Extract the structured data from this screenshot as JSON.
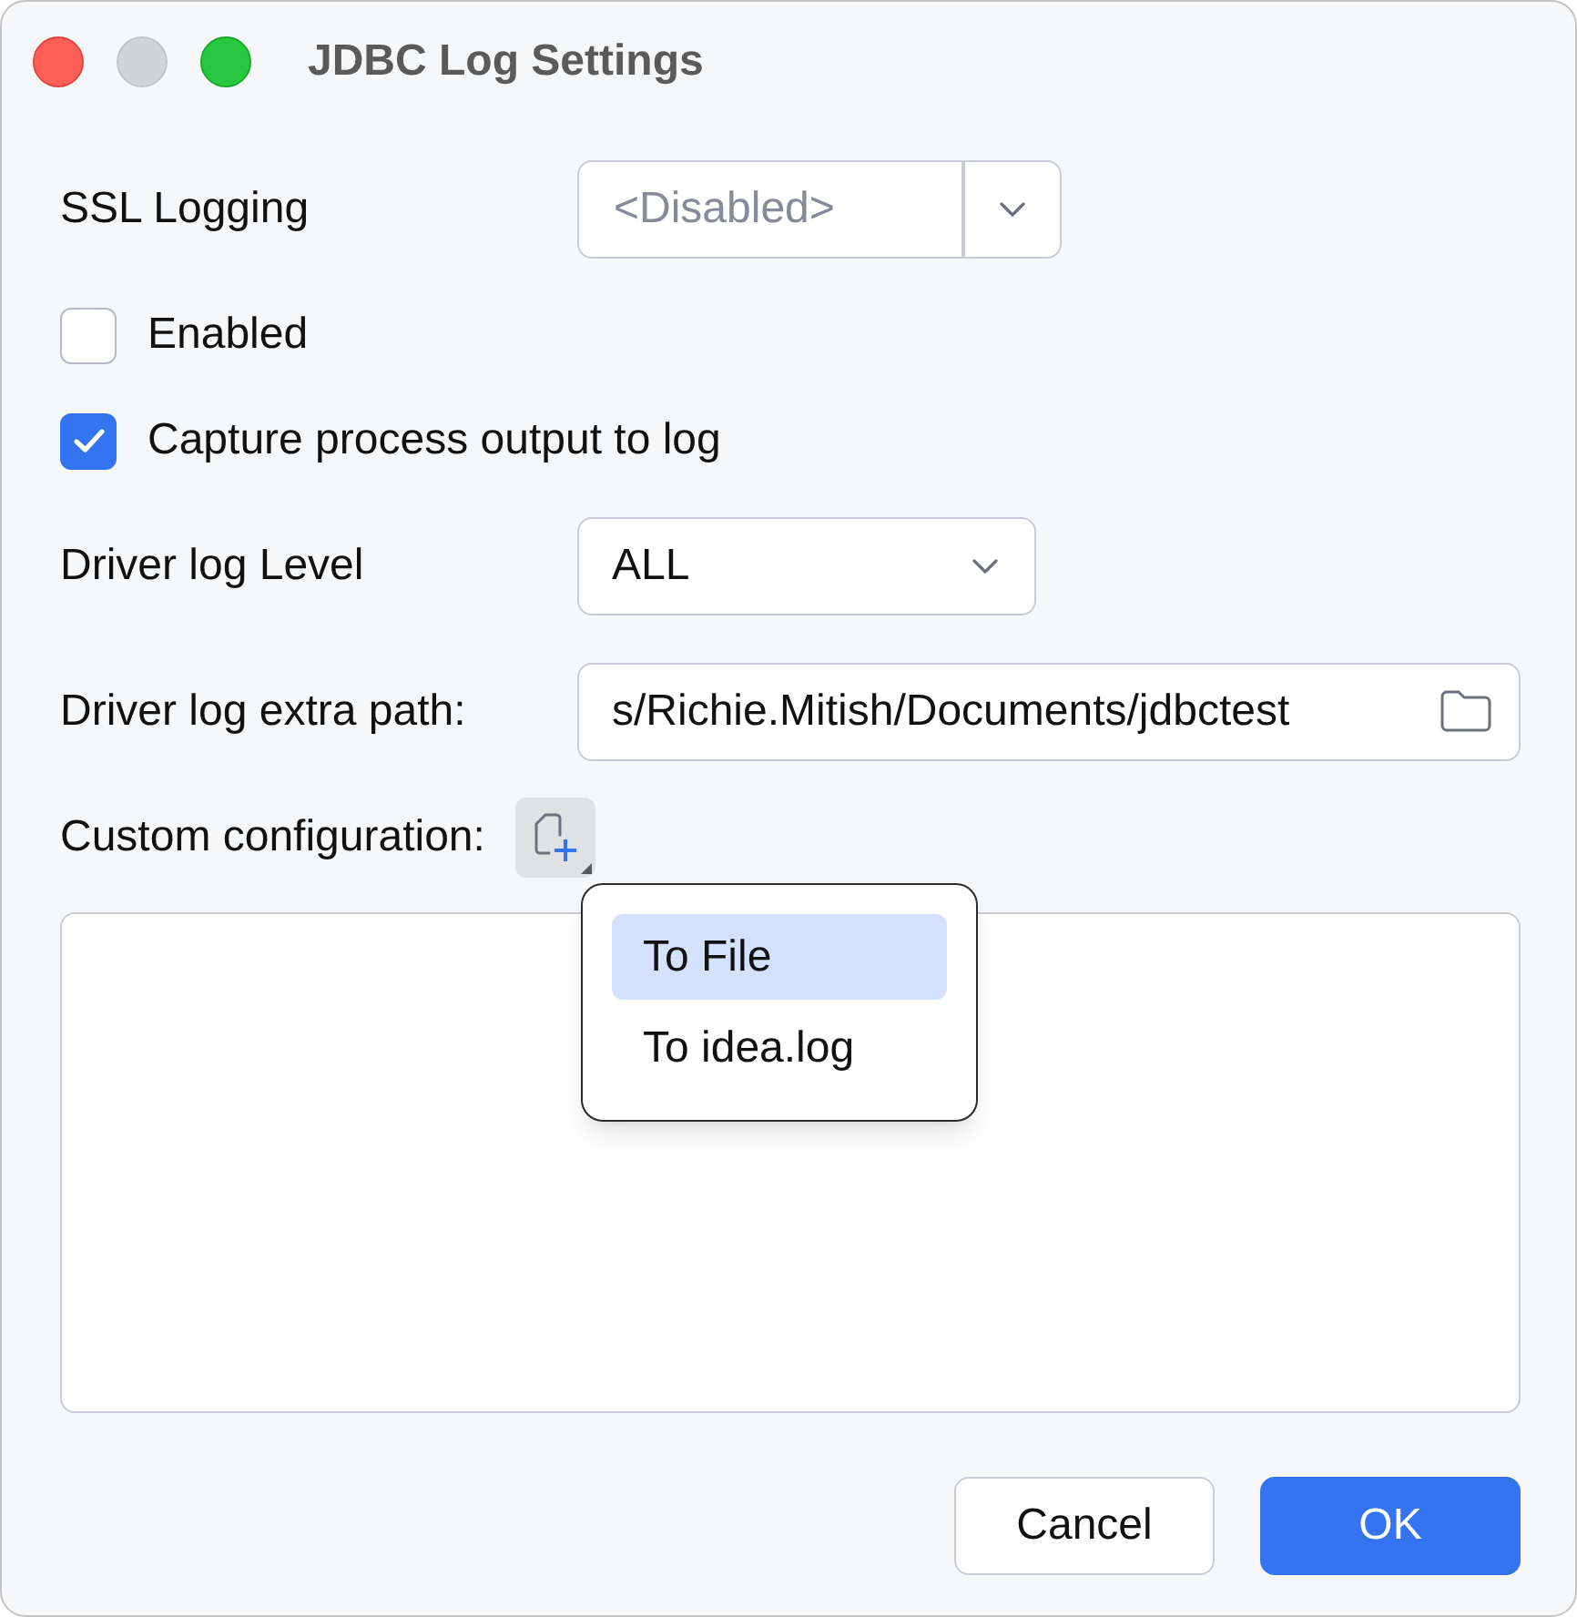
{
  "window": {
    "title": "JDBC Log Settings",
    "buttons": [
      {
        "kind": "close",
        "disabled": false
      },
      {
        "kind": "minimize",
        "disabled": true
      },
      {
        "kind": "zoom",
        "disabled": false
      }
    ]
  },
  "ssl_logging": {
    "label": "SSL Logging",
    "placeholder": "<Disabled>"
  },
  "checkboxes": [
    {
      "label": "Enabled",
      "checked": false
    },
    {
      "label": "Capture process output to log",
      "checked": true
    }
  ],
  "driver_log_level": {
    "label": "Driver log Level",
    "value": "ALL"
  },
  "driver_log_extra_path": {
    "label": "Driver log extra path:",
    "value": "s/Richie.Mitish/Documents/jdbctest"
  },
  "custom_configuration": {
    "label": "Custom configuration:"
  },
  "popup_menu": {
    "items": [
      {
        "label": "To File",
        "selected": true
      },
      {
        "label": "To idea.log",
        "selected": false
      }
    ]
  },
  "buttons": [
    {
      "label": "Cancel",
      "kind": "secondary"
    },
    {
      "label": "OK",
      "kind": "primary"
    }
  ]
}
